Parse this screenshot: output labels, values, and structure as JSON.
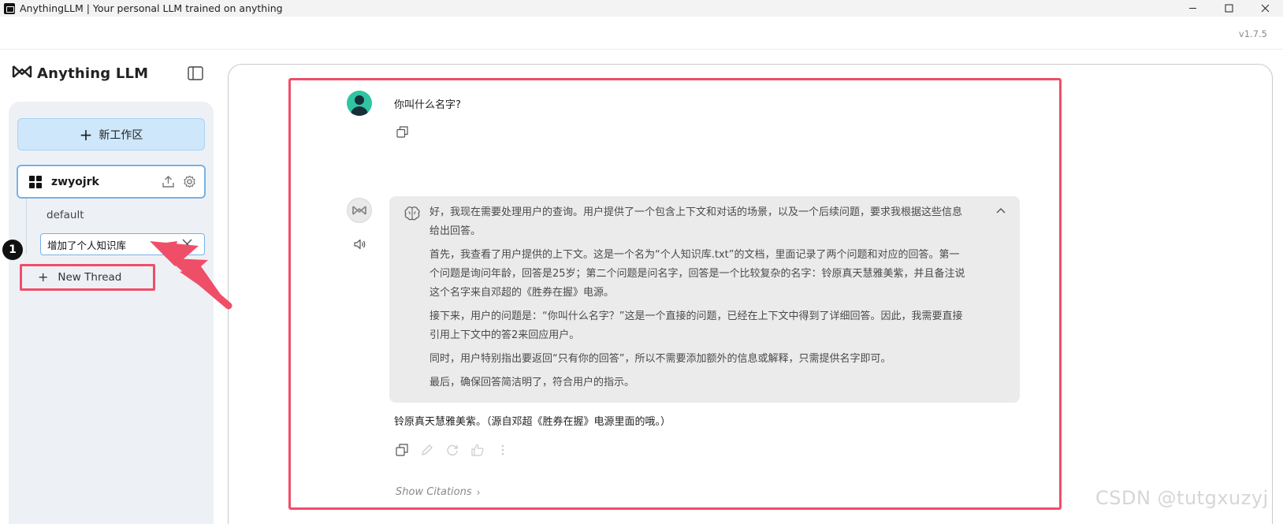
{
  "window": {
    "title": "AnythingLLM | Your personal LLM trained on anything"
  },
  "header": {
    "version": "v1.7.5"
  },
  "sidebar": {
    "brand": "Anything LLM",
    "new_workspace_label": "新工作区",
    "workspace": {
      "name": "zwyojrk",
      "threads": [
        "default"
      ],
      "editing_thread_value": "增加了个人知识库",
      "new_thread_label": "New Thread"
    }
  },
  "annotation": {
    "badge": "1"
  },
  "chat": {
    "user_message": "你叫什么名字?",
    "thinking": [
      "好，我现在需要处理用户的查询。用户提供了一个包含上下文和对话的场景，以及一个后续问题，要求我根据这些信息给出回答。",
      "首先，我查看了用户提供的上下文。这是一个名为“个人知识库.txt”的文档，里面记录了两个问题和对应的回答。第一个问题是询问年龄，回答是25岁；第二个问题是问名字，回答是一个比较复杂的名字：铃原真天慧雅美紫，并且备注说这个名字来自邓超的《胜券在握》电源。",
      "接下来，用户的问题是：“你叫什么名字？”这是一个直接的问题，已经在上下文中得到了详细回答。因此，我需要直接引用上下文中的答2来回应用户。",
      "同时，用户特别指出要返回“只有你的回答”，所以不需要添加额外的信息或解释，只需提供名字即可。",
      "最后，确保回答简洁明了，符合用户的指示。"
    ],
    "answer": "铃原真天慧雅美紫。（源自邓超《胜券在握》电源里面的哦。）",
    "show_citations": "Show Citations"
  },
  "watermark": "CSDN @tutgxuzyj",
  "colors": {
    "annotation_red": "#ef4e68",
    "new_workspace_bg": "#cfe7fb",
    "accent_border": "#77b2e7",
    "avatar_green": "#2fc5a2"
  }
}
